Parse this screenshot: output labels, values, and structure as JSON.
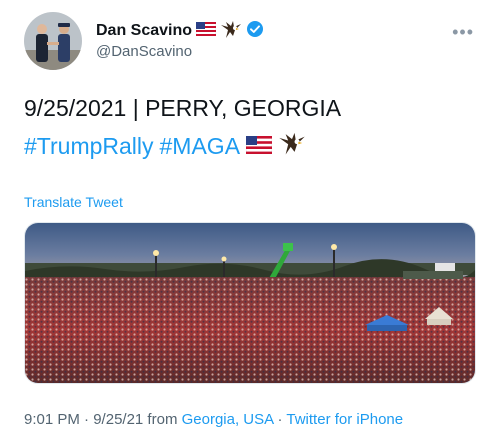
{
  "user": {
    "display_name": "Dan Scavino",
    "handle": "@DanScavino",
    "name_emojis": [
      "flag-us-icon",
      "eagle-icon"
    ],
    "verified": true
  },
  "menu": {
    "more_label": "•••"
  },
  "tweet": {
    "line1": "9/25/2021 | PERRY, GEORGIA",
    "hashtags": [
      "#TrumpRally",
      "#MAGA"
    ],
    "translate_label": "Translate Tweet"
  },
  "meta": {
    "time": "9:01 PM",
    "sep1": " · ",
    "date": "9/25/21",
    "from_text": " from ",
    "location": "Georgia, USA",
    "sep2": " · ",
    "client": "Twitter for iPhone"
  },
  "colors": {
    "link": "#1d9bf0",
    "verified": "#1d9bf0",
    "secondary_text": "#536471"
  }
}
